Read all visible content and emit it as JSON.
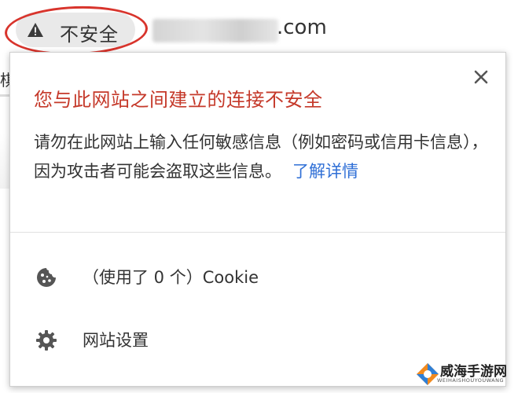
{
  "address_bar": {
    "security_label": "不安全",
    "url_visible": ".com"
  },
  "popup": {
    "title": "您与此网站之间建立的连接不安全",
    "description": "请勿在此网站上输入任何敏感信息（例如密码或信用卡信息），因为攻击者可能会盗取这些信息。",
    "learn_more": "了解详情",
    "cookies_label": "（使用了 0 个）Cookie",
    "site_settings_label": "网站设置"
  },
  "edge_fragment": "棋",
  "watermark": {
    "name": "威海手游网",
    "sub": "WEIHAISHOUYOUWANG"
  },
  "colors": {
    "title_red": "#c5392a",
    "link_blue": "#2f6fd6",
    "highlight_red": "#d8342c",
    "chip_bg": "#e9e9e9"
  },
  "icons": {
    "security": "warning-triangle-icon",
    "close": "close-icon",
    "cookies": "cookie-icon",
    "settings": "gear-icon"
  }
}
